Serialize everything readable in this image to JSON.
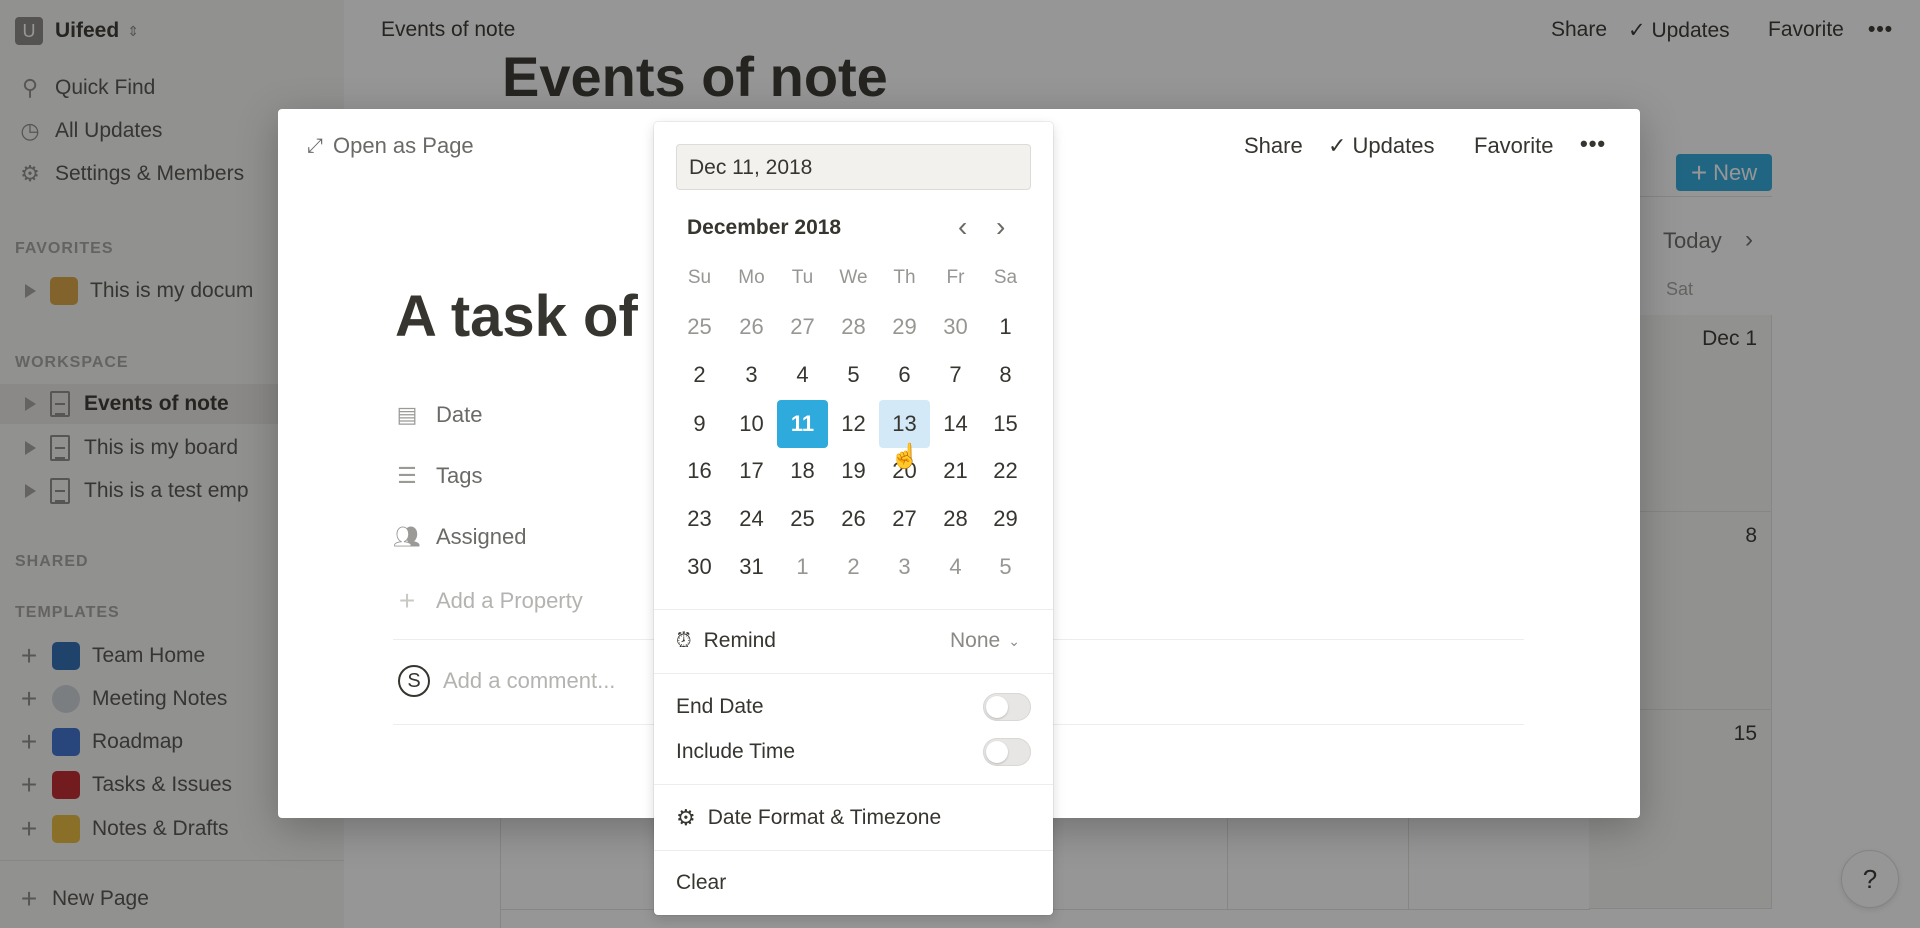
{
  "sidebar": {
    "workspace": {
      "initial": "U",
      "name": "Uifeed"
    },
    "nav": [
      {
        "label": "Quick Find",
        "icon": "search-icon"
      },
      {
        "label": "All Updates",
        "icon": "clock-icon"
      },
      {
        "label": "Settings & Members",
        "icon": "gear-icon"
      }
    ],
    "favorites_header": "FAVORITES",
    "favorites": [
      {
        "label": "This is my docum"
      }
    ],
    "workspace_header": "WORKSPACE",
    "workspace_items": [
      {
        "label": "Events of note",
        "active": true
      },
      {
        "label": "This is my board"
      },
      {
        "label": "This is a test emp"
      }
    ],
    "shared_header": "SHARED",
    "templates_header": "TEMPLATES",
    "templates": [
      {
        "label": "Team Home",
        "color": "#2b6cb0"
      },
      {
        "label": "Meeting Notes",
        "color": "#cfd4da"
      },
      {
        "label": "Roadmap",
        "color": "#3b6fd1"
      },
      {
        "label": "Tasks & Issues",
        "color": "#c0262d"
      },
      {
        "label": "Notes & Drafts",
        "color": "#e8b93a"
      }
    ],
    "new_page": "New Page"
  },
  "topbar": {
    "breadcrumb": "Events of note",
    "share": "Share",
    "updates": "Updates",
    "favorite": "Favorite"
  },
  "page": {
    "title": "Events of note",
    "new_button": "New",
    "today": "Today",
    "weekday_sat": "Sat",
    "cells": [
      "Dec 1",
      "8",
      "15"
    ]
  },
  "modal": {
    "open_as_page": "Open as Page",
    "share": "Share",
    "updates": "Updates",
    "favorite": "Favorite",
    "title": "A task of",
    "properties": [
      {
        "label": "Date",
        "icon": "calendar-icon"
      },
      {
        "label": "Tags",
        "icon": "list-icon"
      },
      {
        "label": "Assigned",
        "icon": "people-icon"
      }
    ],
    "add_property": "Add a Property",
    "comment_avatar": "S",
    "comment_placeholder": "Add a comment..."
  },
  "date_picker": {
    "input_value": "Dec 11, 2018",
    "month_label": "December 2018",
    "weekdays": [
      "Su",
      "Mo",
      "Tu",
      "We",
      "Th",
      "Fr",
      "Sa"
    ],
    "weeks": [
      [
        [
          25,
          1
        ],
        [
          26,
          1
        ],
        [
          27,
          1
        ],
        [
          28,
          1
        ],
        [
          29,
          1
        ],
        [
          30,
          1
        ],
        [
          1,
          0
        ]
      ],
      [
        [
          2,
          0
        ],
        [
          3,
          0
        ],
        [
          4,
          0
        ],
        [
          5,
          0
        ],
        [
          6,
          0
        ],
        [
          7,
          0
        ],
        [
          8,
          0
        ]
      ],
      [
        [
          9,
          0
        ],
        [
          10,
          0
        ],
        [
          11,
          0
        ],
        [
          12,
          0
        ],
        [
          13,
          0
        ],
        [
          14,
          0
        ],
        [
          15,
          0
        ]
      ],
      [
        [
          16,
          0
        ],
        [
          17,
          0
        ],
        [
          18,
          0
        ],
        [
          19,
          0
        ],
        [
          20,
          0
        ],
        [
          21,
          0
        ],
        [
          22,
          0
        ]
      ],
      [
        [
          23,
          0
        ],
        [
          24,
          0
        ],
        [
          25,
          0
        ],
        [
          26,
          0
        ],
        [
          27,
          0
        ],
        [
          28,
          0
        ],
        [
          29,
          0
        ]
      ],
      [
        [
          30,
          0
        ],
        [
          31,
          0
        ],
        [
          1,
          1
        ],
        [
          2,
          1
        ],
        [
          3,
          1
        ],
        [
          4,
          1
        ],
        [
          5,
          1
        ]
      ]
    ],
    "selected_day": 11,
    "hovered_day": 13,
    "remind_label": "Remind",
    "remind_value": "None",
    "end_date_label": "End Date",
    "end_date_on": false,
    "include_time_label": "Include Time",
    "include_time_on": false,
    "format_label": "Date Format & Timezone",
    "clear_label": "Clear",
    "accent": "#2eaadc"
  },
  "help": "?"
}
